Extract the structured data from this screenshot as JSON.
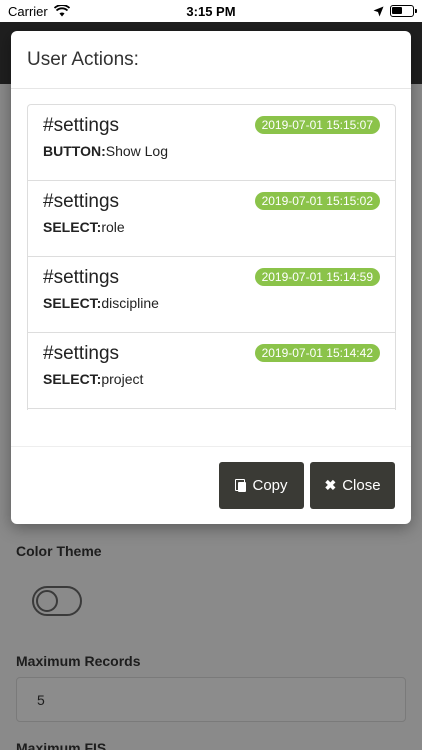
{
  "status_bar": {
    "carrier": "Carrier",
    "time": "3:15 PM"
  },
  "modal": {
    "title": "User Actions:",
    "logs": [
      {
        "hash": "#settings",
        "type": "BUTTON:",
        "value": "Show Log",
        "time": "2019-07-01 15:15:07"
      },
      {
        "hash": "#settings",
        "type": "SELECT:",
        "value": "role",
        "time": "2019-07-01 15:15:02"
      },
      {
        "hash": "#settings",
        "type": "SELECT:",
        "value": "discipline",
        "time": "2019-07-01 15:14:59"
      },
      {
        "hash": "#settings",
        "type": "SELECT:",
        "value": "project",
        "time": "2019-07-01 15:14:42"
      }
    ],
    "copy_label": "Copy",
    "close_label": "Close"
  },
  "settings": {
    "color_theme_label": "Color Theme",
    "max_records_label": "Maximum Records",
    "max_records_value": "5",
    "max_fis_label": "Maximum FIS"
  },
  "colors": {
    "badge": "#8bc34a",
    "button": "#3a3a35",
    "overlay": "#8a8a8a"
  }
}
